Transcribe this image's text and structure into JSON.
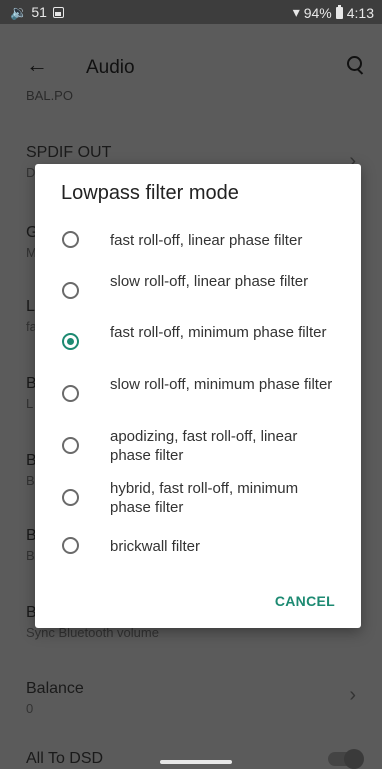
{
  "statusbar": {
    "volume": "🔉 51",
    "battery": "94%",
    "time": "4:13",
    "wifi_icon": "wifi-icon"
  },
  "appbar": {
    "title": "Audio"
  },
  "background_list": [
    {
      "title": "BAL.PO",
      "sub": ""
    },
    {
      "title": "SPDIF OUT",
      "sub": "D"
    },
    {
      "title": "G",
      "sub": "M"
    },
    {
      "title": "L",
      "sub": "fa"
    },
    {
      "title": "B",
      "sub": "L"
    },
    {
      "title": "B",
      "sub": "B"
    },
    {
      "title": "B",
      "sub": "B"
    },
    {
      "title": "B",
      "sub": "Sync Bluetooth volume"
    },
    {
      "title": "Balance",
      "sub": "0"
    },
    {
      "title": "All To DSD",
      "sub": ""
    }
  ],
  "dialog": {
    "title": "Lowpass filter mode",
    "options": [
      {
        "label": "fast roll-off, linear phase filter",
        "checked": false
      },
      {
        "label": "slow roll-off, linear phase filter",
        "checked": false
      },
      {
        "label": "fast roll-off, minimum phase filter",
        "checked": true
      },
      {
        "label": "slow roll-off, minimum phase filter",
        "checked": false
      },
      {
        "label": "apodizing, fast roll-off, linear phase filter",
        "checked": false
      },
      {
        "label": "hybrid, fast roll-off, minimum phase filter",
        "checked": false
      },
      {
        "label": "brickwall filter",
        "checked": false
      }
    ],
    "cancel_label": "CANCEL"
  },
  "colors": {
    "accent": "#1d8a72",
    "scrim": "#5b5b5b"
  }
}
